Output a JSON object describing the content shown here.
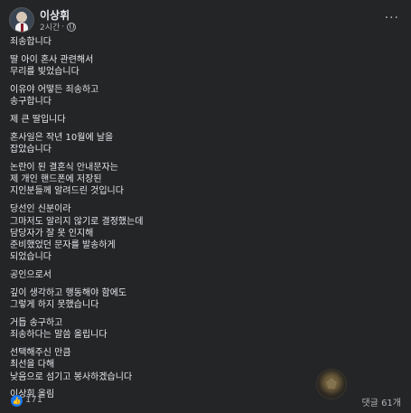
{
  "post": {
    "author": "이상휘",
    "timestamp": "2시간",
    "dot": "·",
    "more_label": "···",
    "paragraphs": [
      "죄송합니다",
      "딸 아이 혼사 관련해서\n무리를 빚었습니다",
      "이유야 어떻든 죄송하고\n송구합니다",
      "제 큰 딸입니다",
      "혼사일은 작년 10월에 날을\n잡았습니다",
      "논란이 된 결혼식 안내문자는\n제 개인 핸드폰에 저장된\n지인분들께 알려드린 것입니다",
      "당선인 신분이라\n그마저도 알리지 않기로 결정했는데\n담당자가 잘 못 인지해\n준비했었던 문자를 발송하게\n되었습니다",
      "공인으로서",
      "깊이 생각하고 행동해야 함에도\n그렇게 하지 못했습니다",
      "거듭 송구하고\n죄송하다는 말씀 올립니다",
      "선택해주신 만큼\n최선을 다해\n 낮음으로 섬기고 봉사하겠습니다",
      "이상휘 올림"
    ]
  },
  "footer": {
    "like_icon": "thumbs-up-icon",
    "like_count": "171",
    "comments_label": "댓글 61개"
  },
  "colors": {
    "background": "#242526",
    "text": "#e4e6eb",
    "secondary_text": "#b0b3b8",
    "like_blue": "#1877f2"
  }
}
